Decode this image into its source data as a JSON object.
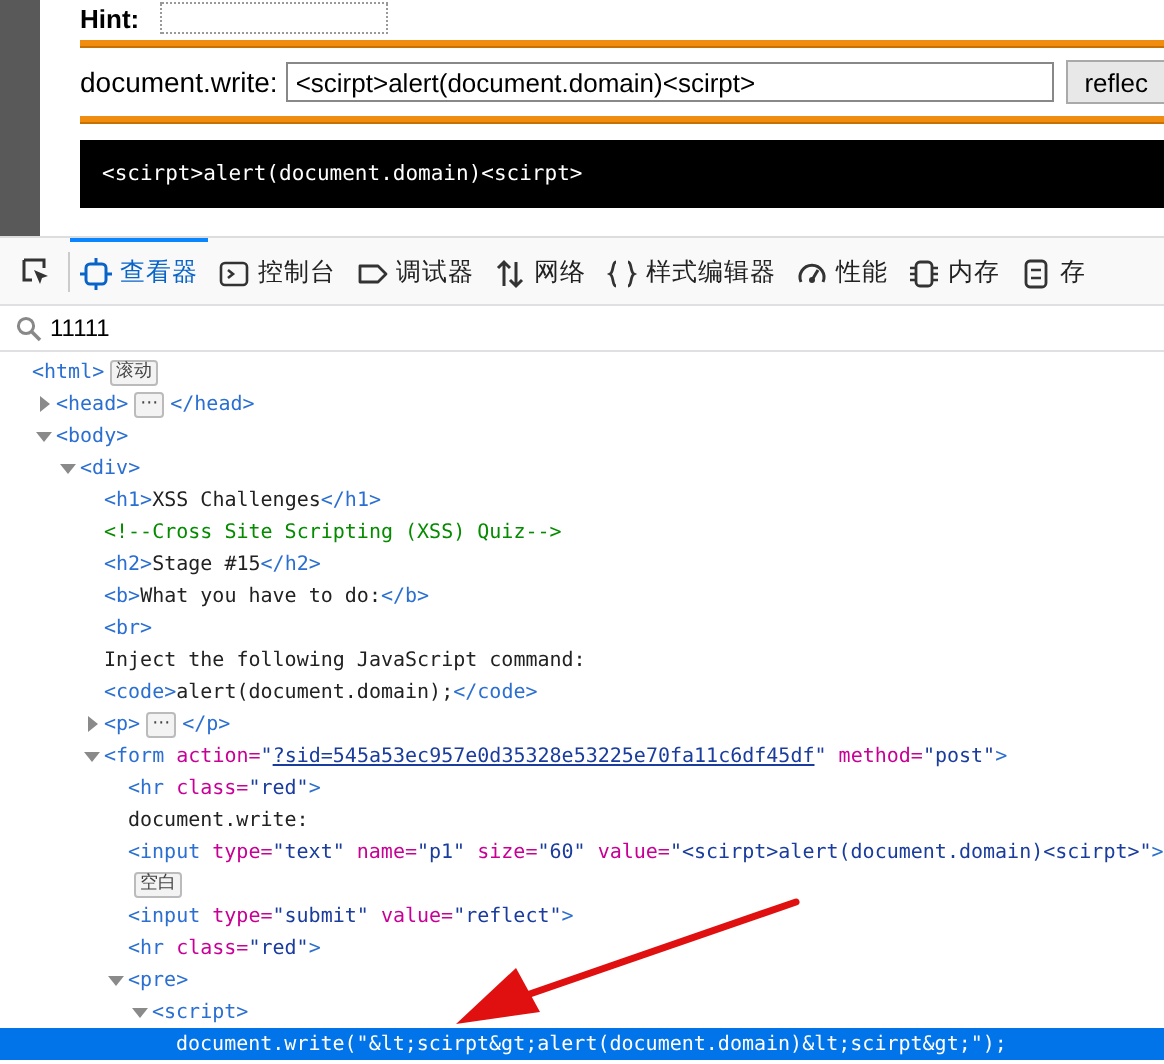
{
  "page": {
    "hint_label": "Hint:",
    "field_label": "document.write:",
    "field_value": "<scirpt>alert(document.domain)<scirpt>",
    "button": "reflec",
    "output": "<scirpt>alert(document.domain)<scirpt>"
  },
  "devtools": {
    "tabs": [
      {
        "label": "查看器",
        "selected": true
      },
      {
        "label": "控制台",
        "selected": false
      },
      {
        "label": "调试器",
        "selected": false
      },
      {
        "label": "网络",
        "selected": false
      },
      {
        "label": "样式编辑器",
        "selected": false
      },
      {
        "label": "性能",
        "selected": false
      },
      {
        "label": "内存",
        "selected": false
      },
      {
        "label": "存",
        "selected": false
      }
    ],
    "search": {
      "value": "11111"
    },
    "tree": {
      "parts": [
        {
          "kind": "tag",
          "text": "<html>"
        },
        {
          "kind": "badge",
          "text": "滚动"
        }
      ],
      "selected": false,
      "children": [
        {
          "parts": [
            {
              "kind": "tag",
              "text": "<head>"
            },
            {
              "kind": "badge",
              "text": "⋯"
            },
            {
              "kind": "tag",
              "text": "</head>"
            }
          ],
          "selected": false,
          "expanded": false
        },
        {
          "parts": [
            {
              "kind": "tag",
              "text": "<body>"
            }
          ],
          "selected": false,
          "expanded": true,
          "children": [
            {
              "parts": [
                {
                  "kind": "tag",
                  "text": "<div>"
                }
              ],
              "selected": false,
              "expanded": true,
              "children": [
                {
                  "parts": [
                    {
                      "kind": "tag",
                      "text": "<h1>"
                    },
                    {
                      "kind": "text",
                      "text": "XSS Challenges"
                    },
                    {
                      "kind": "tag",
                      "text": "</h1>"
                    }
                  ],
                  "selected": false
                },
                {
                  "parts": [
                    {
                      "kind": "comment",
                      "text": "<!--Cross Site Scripting (XSS) Quiz-->"
                    }
                  ],
                  "selected": false
                },
                {
                  "parts": [
                    {
                      "kind": "tag",
                      "text": "<h2>"
                    },
                    {
                      "kind": "text",
                      "text": "Stage #15"
                    },
                    {
                      "kind": "tag",
                      "text": "</h2>"
                    }
                  ],
                  "selected": false
                },
                {
                  "parts": [
                    {
                      "kind": "tag",
                      "text": "<b>"
                    },
                    {
                      "kind": "text",
                      "text": "What you have to do:"
                    },
                    {
                      "kind": "tag",
                      "text": "</b>"
                    }
                  ],
                  "selected": false
                },
                {
                  "parts": [
                    {
                      "kind": "tag",
                      "text": "<br>"
                    }
                  ],
                  "selected": false
                },
                {
                  "parts": [
                    {
                      "kind": "text",
                      "text": "Inject the following JavaScript command:"
                    }
                  ],
                  "selected": false
                },
                {
                  "parts": [
                    {
                      "kind": "tag",
                      "text": "<code>"
                    },
                    {
                      "kind": "text",
                      "text": "alert(document.domain);"
                    },
                    {
                      "kind": "tag",
                      "text": "</code>"
                    }
                  ],
                  "selected": false
                },
                {
                  "parts": [
                    {
                      "kind": "tag",
                      "text": "<p>"
                    },
                    {
                      "kind": "badge",
                      "text": "⋯"
                    },
                    {
                      "kind": "tag",
                      "text": "</p>"
                    }
                  ],
                  "selected": false,
                  "expanded": false
                },
                {
                  "parts": [
                    {
                      "kind": "tag",
                      "text": "<form"
                    },
                    {
                      "kind": "attr",
                      "text": " action="
                    },
                    {
                      "kind": "value",
                      "text": "\""
                    },
                    {
                      "kind": "link",
                      "text": "?sid=545a53ec957e0d35328e53225e70fa11c6df45df"
                    },
                    {
                      "kind": "value",
                      "text": "\""
                    },
                    {
                      "kind": "attr",
                      "text": " method="
                    },
                    {
                      "kind": "value",
                      "text": "\"post\""
                    },
                    {
                      "kind": "tag",
                      "text": ">"
                    }
                  ],
                  "selected": false,
                  "expanded": true,
                  "children": [
                    {
                      "parts": [
                        {
                          "kind": "tag",
                          "text": "<hr"
                        },
                        {
                          "kind": "attr",
                          "text": " class="
                        },
                        {
                          "kind": "value",
                          "text": "\"red\""
                        },
                        {
                          "kind": "tag",
                          "text": ">"
                        }
                      ],
                      "selected": false
                    },
                    {
                      "parts": [
                        {
                          "kind": "text",
                          "text": "document.write:"
                        }
                      ],
                      "selected": false
                    },
                    {
                      "parts": [
                        {
                          "kind": "tag",
                          "text": "<input"
                        },
                        {
                          "kind": "attr",
                          "text": " type="
                        },
                        {
                          "kind": "value",
                          "text": "\"text\""
                        },
                        {
                          "kind": "attr",
                          "text": " name="
                        },
                        {
                          "kind": "value",
                          "text": "\"p1\""
                        },
                        {
                          "kind": "attr",
                          "text": " size="
                        },
                        {
                          "kind": "value",
                          "text": "\"60\""
                        },
                        {
                          "kind": "attr",
                          "text": " value="
                        },
                        {
                          "kind": "value",
                          "text": "\"<scirpt>alert(document.domain)<scirpt>\""
                        },
                        {
                          "kind": "tag",
                          "text": ">"
                        }
                      ],
                      "selected": false
                    },
                    {
                      "parts": [
                        {
                          "kind": "badge",
                          "text": "空白"
                        }
                      ],
                      "selected": false
                    },
                    {
                      "parts": [
                        {
                          "kind": "tag",
                          "text": "<input"
                        },
                        {
                          "kind": "attr",
                          "text": " type="
                        },
                        {
                          "kind": "value",
                          "text": "\"submit\""
                        },
                        {
                          "kind": "attr",
                          "text": " value="
                        },
                        {
                          "kind": "value",
                          "text": "\"reflect\""
                        },
                        {
                          "kind": "tag",
                          "text": ">"
                        }
                      ],
                      "selected": false
                    },
                    {
                      "parts": [
                        {
                          "kind": "tag",
                          "text": "<hr"
                        },
                        {
                          "kind": "attr",
                          "text": " class="
                        },
                        {
                          "kind": "value",
                          "text": "\"red\""
                        },
                        {
                          "kind": "tag",
                          "text": ">"
                        }
                      ],
                      "selected": false
                    },
                    {
                      "parts": [
                        {
                          "kind": "tag",
                          "text": "<pre>"
                        }
                      ],
                      "selected": false,
                      "expanded": true,
                      "children": [
                        {
                          "parts": [
                            {
                              "kind": "tag",
                              "text": "<script>"
                            }
                          ],
                          "selected": false,
                          "expanded": true,
                          "children": [
                            {
                              "parts": [
                                {
                                  "kind": "text",
                                  "text": "document.write(\"&lt;scirpt&gt;alert(document.domain)&lt;scirpt&gt;\");"
                                }
                              ],
                              "selected": true
                            }
                          ]
                        }
                      ]
                    }
                  ]
                }
              ]
            }
          ]
        }
      ]
    }
  }
}
